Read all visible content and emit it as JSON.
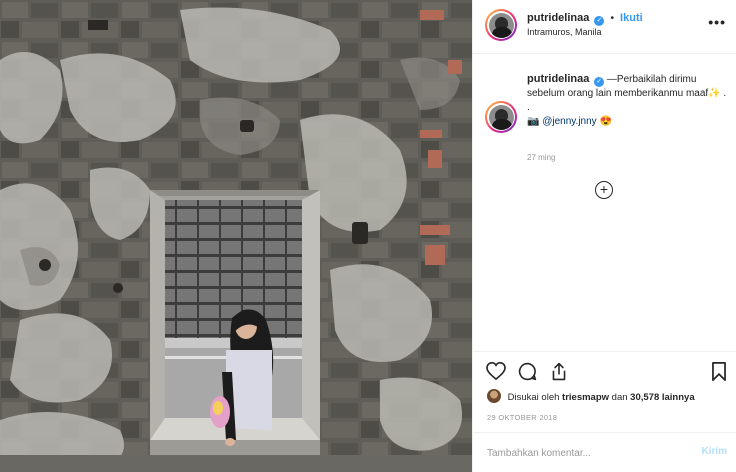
{
  "post": {
    "photo_alt": "",
    "user": {
      "username": "putridelinaa",
      "verified_icon": "verified-badge-icon",
      "separator": "•",
      "follow_label": "Ikuti",
      "location": "Intramuros, Manila"
    },
    "more_icon": "more-options-icon",
    "more_label": "•••",
    "caption": {
      "username": "putridelinaa",
      "text": "—Perbaikilah dirimu sebelum orang lain memberikanmu maaf",
      "text_suffix": " .",
      "dot_line": ".",
      "camera_icon": "camera-icon",
      "mention": "@jenny.jnny",
      "emoji_icon": "heart-eyes-emoji-icon",
      "time_ago": "27 ming"
    },
    "load_more_icon": "plus-circle-icon",
    "load_more_label": "+",
    "actions": {
      "like_icon": "heart-icon",
      "comment_icon": "comment-icon",
      "share_icon": "share-icon",
      "save_icon": "bookmark-icon"
    },
    "likes": {
      "prefix": "Disukai oleh",
      "liker": "triesmapw",
      "connector": "dan",
      "count": "30,578 lainnya"
    },
    "date": "29 OKTOBER 2018",
    "comment_box": {
      "placeholder": "Tambahkan komentar...",
      "post_label": "Kirim"
    },
    "colors": {
      "link_blue": "#3897f0",
      "mention_blue": "#003569",
      "muted_gray": "#999999",
      "disabled_post": "#b2dffc",
      "border": "#efefef"
    }
  }
}
